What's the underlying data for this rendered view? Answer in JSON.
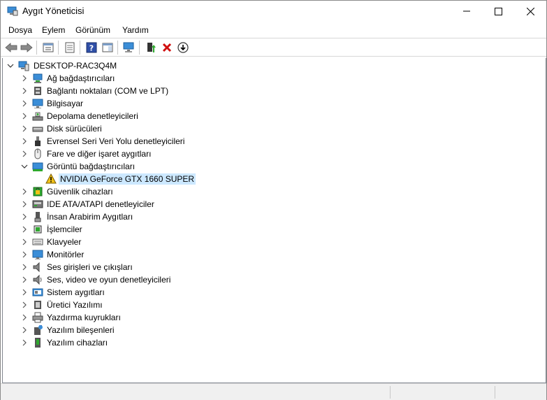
{
  "window": {
    "title": "Aygıt Yöneticisi"
  },
  "menu": [
    "Dosya",
    "Eylem",
    "Görünüm",
    "Yardım"
  ],
  "toolbar_icons": [
    "back-icon",
    "forward-icon",
    "properties-view-icon",
    "console-tree-icon",
    "help-icon",
    "action-pane-icon",
    "scan-hardware-icon",
    "update-driver-icon",
    "uninstall-icon",
    "disable-device-icon"
  ],
  "tree": {
    "root": "DESKTOP-RAC3Q4M",
    "categories": [
      {
        "label": "Ağ bağdaştırıcıları",
        "icon": "network-adapter-icon"
      },
      {
        "label": "Bağlantı noktaları (COM ve LPT)",
        "icon": "port-icon"
      },
      {
        "label": "Bilgisayar",
        "icon": "computer-icon"
      },
      {
        "label": "Depolama denetleyicileri",
        "icon": "storage-controller-icon"
      },
      {
        "label": "Disk sürücüleri",
        "icon": "disk-drive-icon"
      },
      {
        "label": "Evrensel Seri Veri Yolu denetleyicileri",
        "icon": "usb-icon"
      },
      {
        "label": "Fare ve diğer işaret aygıtları",
        "icon": "mouse-icon"
      },
      {
        "label": "Görüntü bağdaştırıcıları",
        "icon": "display-adapter-icon",
        "expanded": true,
        "children": [
          {
            "label": "NVIDIA GeForce GTX 1660 SUPER",
            "icon": "warning-icon",
            "selected": true
          }
        ]
      },
      {
        "label": "Güvenlik cihazları",
        "icon": "security-device-icon"
      },
      {
        "label": "IDE ATA/ATAPI denetleyiciler",
        "icon": "ide-controller-icon"
      },
      {
        "label": "İnsan Arabirim Aygıtları",
        "icon": "hid-icon"
      },
      {
        "label": "İşlemciler",
        "icon": "processor-icon"
      },
      {
        "label": "Klavyeler",
        "icon": "keyboard-icon"
      },
      {
        "label": "Monitörler",
        "icon": "monitor-icon"
      },
      {
        "label": "Ses girişleri ve çıkışları",
        "icon": "speaker-icon"
      },
      {
        "label": "Ses, video ve oyun denetleyicileri",
        "icon": "sound-controller-icon"
      },
      {
        "label": "Sistem aygıtları",
        "icon": "system-device-icon"
      },
      {
        "label": "Üretici Yazılımı",
        "icon": "firmware-icon"
      },
      {
        "label": "Yazdırma kuyrukları",
        "icon": "printer-icon"
      },
      {
        "label": "Yazılım bileşenleri",
        "icon": "software-component-icon"
      },
      {
        "label": "Yazılım cihazları",
        "icon": "software-device-icon"
      }
    ]
  }
}
